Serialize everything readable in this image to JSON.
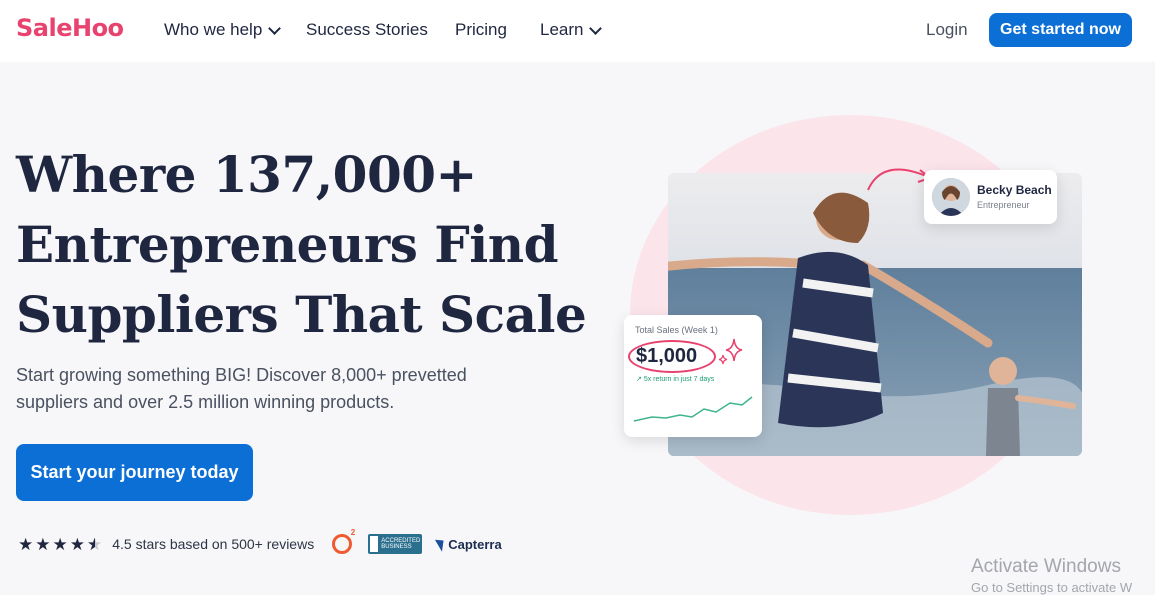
{
  "nav": {
    "logo": "SaleHoo",
    "items": [
      {
        "label": "Who we help",
        "has_dropdown": true
      },
      {
        "label": "Success Stories",
        "has_dropdown": false
      },
      {
        "label": "Pricing",
        "has_dropdown": false
      },
      {
        "label": "Learn",
        "has_dropdown": true
      }
    ],
    "login": "Login",
    "cta": "Get started now"
  },
  "hero": {
    "headline_lines": [
      "Where 137,000+",
      "Entrepreneurs Find",
      "Suppliers That Scale"
    ],
    "subtitle": "Start growing something BIG! Discover 8,000+ prevetted suppliers and over 2.5 million winning products.",
    "cta": "Start your journey today",
    "rating_text": "4.5 stars based on 500+ reviews",
    "rating_value": 4.5,
    "badges": {
      "g2_icon": "g2-icon",
      "bbb_text": "ACCREDITED BUSINESS",
      "capterra": "Capterra"
    }
  },
  "testimonial": {
    "name": "Becky Beach",
    "role": "Entrepreneur"
  },
  "sales_card": {
    "label": "Total Sales (Week 1)",
    "value": "$1,000",
    "growth": "5x return in just 7 days"
  },
  "colors": {
    "brand": "#e8436f",
    "primary": "#0b6fd6",
    "text": "#1f2640",
    "blob": "#fbe4ea",
    "growth": "#1a9c75"
  },
  "watermark": {
    "line1": "Activate Windows",
    "line2": "Go to Settings to activate W"
  }
}
